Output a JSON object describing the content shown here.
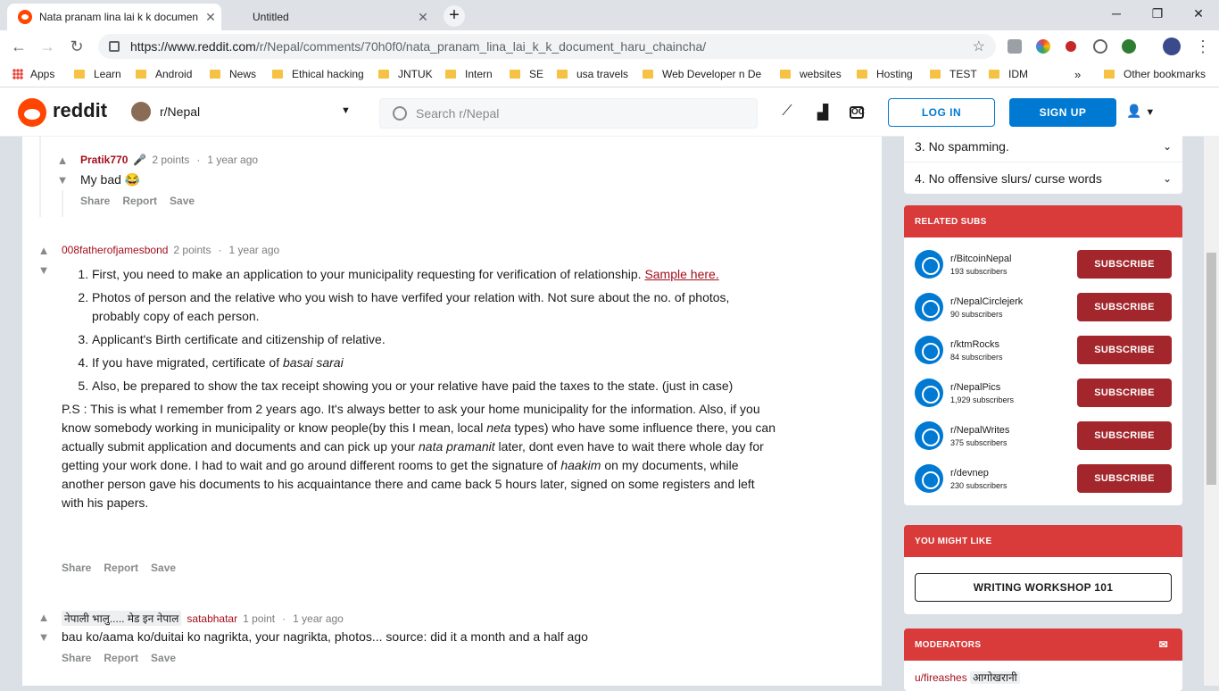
{
  "browser": {
    "tabs": [
      {
        "title": "Nata pranam lina lai k k documen",
        "active": true
      },
      {
        "title": "Untitled",
        "active": false
      }
    ],
    "url_host": "https://www.reddit.com",
    "url_path": "/r/Nepal/comments/70h0f0/nata_pranam_lina_lai_k_k_document_haru_chaincha/",
    "bookmarks": [
      "Apps",
      "Learn",
      "Android",
      "News",
      "Ethical hacking",
      "JNTUK",
      "Intern",
      "SE",
      "usa travels",
      "Web Developer n De",
      "websites",
      "Hosting",
      "TEST",
      "IDM"
    ],
    "other_bookmarks": "Other bookmarks",
    "overflow": "»"
  },
  "header": {
    "logo_text": "reddit",
    "subreddit": "r/Nepal",
    "search_placeholder": "Search r/Nepal",
    "login": "LOG IN",
    "signup": "SIGN UP"
  },
  "comments": [
    {
      "author": "Pratik770",
      "points": "2 points",
      "time": "1 year ago",
      "body": "My bad 😂",
      "actions": [
        "Share",
        "Report",
        "Save"
      ]
    },
    {
      "author": "008fatherofjamesbond",
      "points": "2 points",
      "time": "1 year ago",
      "list": [
        {
          "text": "First, you need to make an application to your municipality requesting for verification of relationship. ",
          "link": "Sample here."
        },
        {
          "text": "Photos of person and the relative who you wish to have verfifed your relation with. Not sure about the no. of photos, probably copy of each person."
        },
        {
          "text": "Applicant's Birth certificate and citizenship of relative."
        },
        {
          "text": "If you have migrated, certificate of ",
          "em": "basai sarai"
        },
        {
          "text": "Also, be prepared to show the tax receipt showing you or your relative have paid the taxes to the state. (just in case)"
        }
      ],
      "ps_parts": {
        "a": "P.S : This is what I remember from 2 years ago. It's always better to ask your home municipality for the information. Also, if you know somebody working in municipality or know people(by this I mean, local ",
        "neta": "neta",
        "b": " types) who have some influence there, you can actually submit application and documents and can pick up your ",
        "nata": "nata pramanit",
        "c": " later, dont even have to wait there whole day for getting your work done. I had to wait and go around different rooms to get the signature of ",
        "haakim": "haakim",
        "d": " on my documents, while another person gave his documents to his acquaintance there and came back 5 hours later, signed on some registers and left with his papers."
      },
      "actions": [
        "Share",
        "Report",
        "Save"
      ]
    },
    {
      "flair": "नेपाली भालु..... मेड इन नेपाल",
      "author": "satabhatar",
      "points": "1 point",
      "time": "1 year ago",
      "body": "bau ko/aama ko/duitai ko nagrikta, your nagrikta, photos... source: did it a month and a half ago",
      "actions": [
        "Share",
        "Report",
        "Save"
      ]
    }
  ],
  "sidebar": {
    "rules": [
      "3. No spamming.",
      "4. No offensive slurs/ curse words"
    ],
    "related_title": "RELATED SUBS",
    "related": [
      {
        "name": "r/BitcoinNepal",
        "subs": "193 subscribers"
      },
      {
        "name": "r/NepalCirclejerk",
        "subs": "90 subscribers"
      },
      {
        "name": "r/ktmRocks",
        "subs": "84 subscribers"
      },
      {
        "name": "r/NepalPics",
        "subs": "1,929 subscribers"
      },
      {
        "name": "r/NepalWrites",
        "subs": "375 subscribers"
      },
      {
        "name": "r/devnep",
        "subs": "230 subscribers"
      }
    ],
    "subscribe": "SUBSCRIBE",
    "might_like_title": "YOU MIGHT LIKE",
    "might_like_item": "WRITING WORKSHOP 101",
    "moderators_title": "MODERATORS",
    "moderator": "u/fireashes",
    "moderator_flair": "आगोखरानी"
  }
}
